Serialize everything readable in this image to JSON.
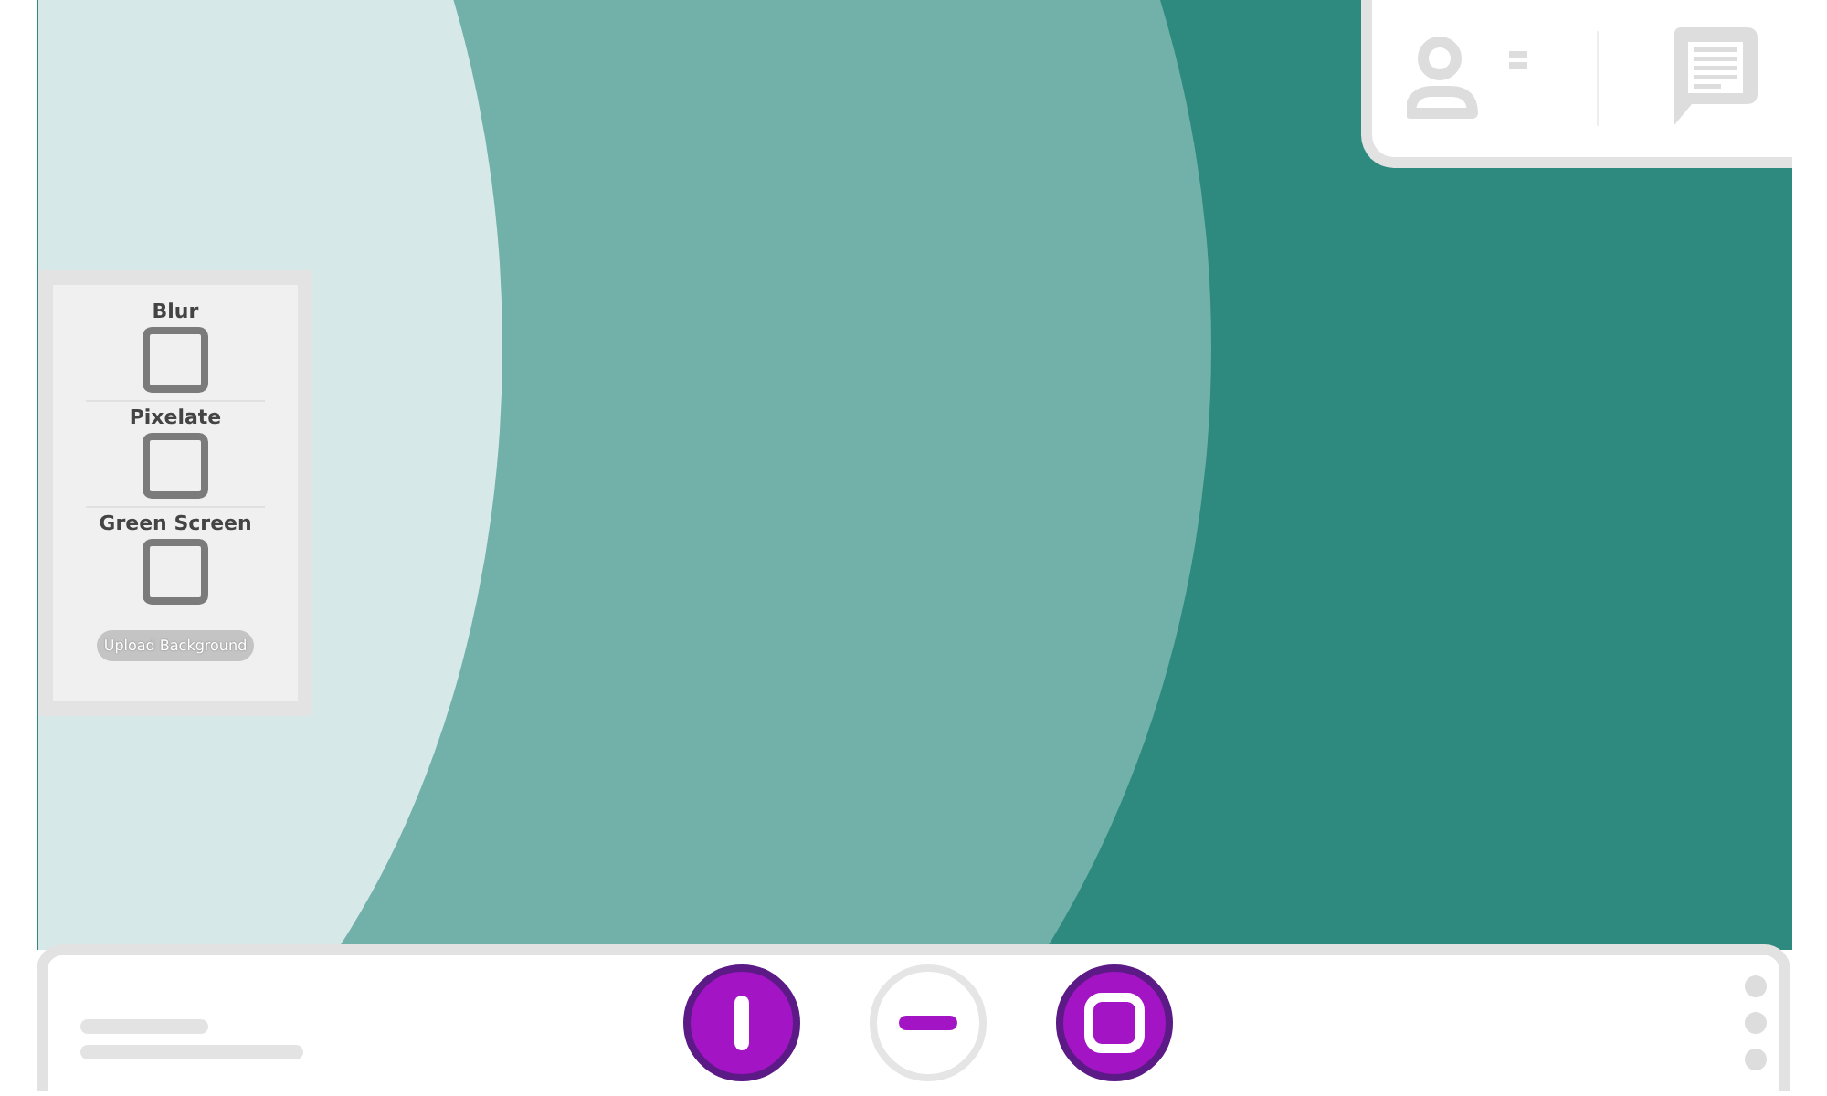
{
  "effects_panel": {
    "effects": [
      {
        "label": "Blur",
        "checked": false
      },
      {
        "label": "Pixelate",
        "checked": false
      },
      {
        "label": "Green Screen",
        "checked": false
      }
    ],
    "upload_button": "Upload Background"
  },
  "call_controls": [
    {
      "kind": "mic",
      "on": true
    },
    {
      "kind": "hangup",
      "on": false
    },
    {
      "kind": "camera",
      "on": true
    }
  ]
}
